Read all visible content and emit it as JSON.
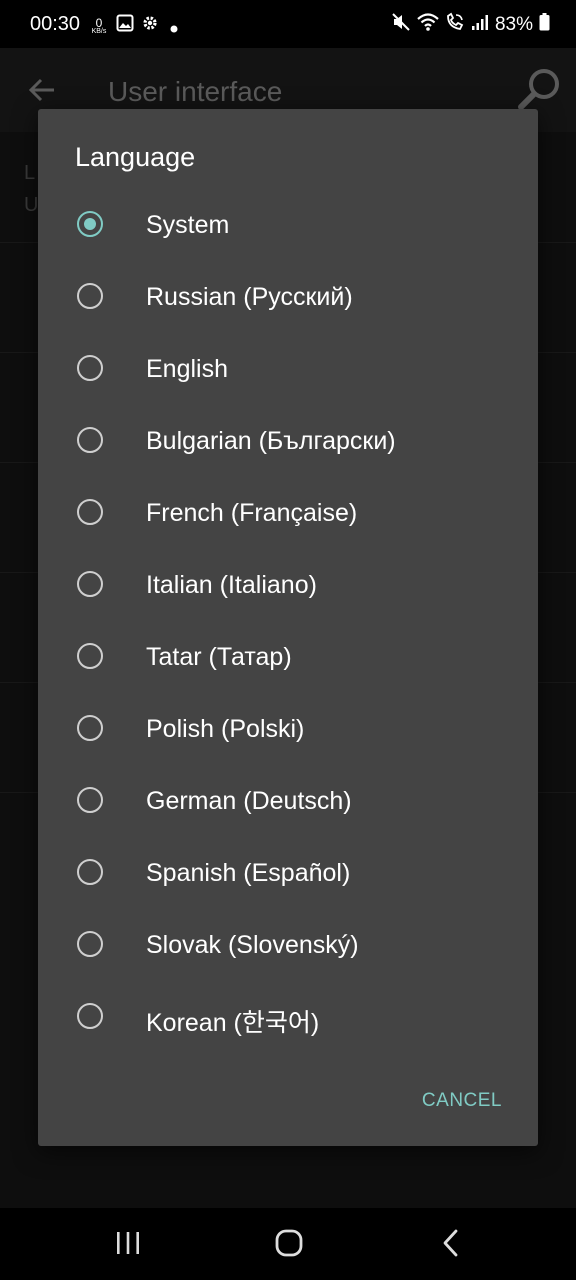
{
  "status_bar": {
    "time": "00:30",
    "net_speed_value": "0",
    "net_speed_unit": "KB/s",
    "battery": "83%",
    "icons": [
      "image-icon",
      "gear-icon",
      "dot-icon",
      "mute-icon",
      "wifi-icon",
      "wifi-call-icon",
      "signal-icon",
      "battery-icon"
    ]
  },
  "app_bar": {
    "title": "User interface",
    "icons": [
      "back-arrow-icon",
      "search-icon"
    ]
  },
  "background_rows": [
    {
      "line1": "L",
      "line2": "U"
    }
  ],
  "dialog": {
    "title": "Language",
    "options": [
      {
        "label": "System",
        "selected": true
      },
      {
        "label": "Russian (Русский)",
        "selected": false
      },
      {
        "label": "English",
        "selected": false
      },
      {
        "label": "Bulgarian (Български)",
        "selected": false
      },
      {
        "label": "French (Française)",
        "selected": false
      },
      {
        "label": "Italian (Italiano)",
        "selected": false
      },
      {
        "label": "Tatar (Татар)",
        "selected": false
      },
      {
        "label": "Polish (Polski)",
        "selected": false
      },
      {
        "label": "German (Deutsch)",
        "selected": false
      },
      {
        "label": "Spanish (Español)",
        "selected": false
      },
      {
        "label": "Slovak (Slovenský)",
        "selected": false
      },
      {
        "label": "Korean (한국어)",
        "selected": false
      }
    ],
    "cancel_label": "CANCEL",
    "accent_color": "#80cbc4"
  },
  "nav_bar": {
    "icons": [
      "recents-icon",
      "home-icon",
      "back-icon"
    ]
  }
}
